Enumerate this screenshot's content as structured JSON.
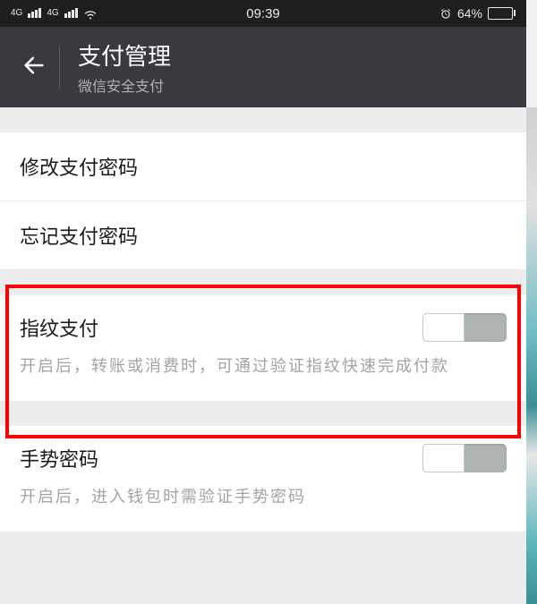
{
  "status": {
    "network_label": "4G",
    "time": "09:39",
    "battery_pct": "64%"
  },
  "header": {
    "title": "支付管理",
    "subtitle": "微信安全支付"
  },
  "items": {
    "change_pwd": "修改支付密码",
    "forgot_pwd": "忘记支付密码"
  },
  "fingerprint": {
    "title": "指纹支付",
    "desc": "开启后，转账或消费时，可通过验证指纹快速完成付款"
  },
  "gesture": {
    "title": "手势密码",
    "desc": "开启后，进入钱包时需验证手势密码"
  }
}
